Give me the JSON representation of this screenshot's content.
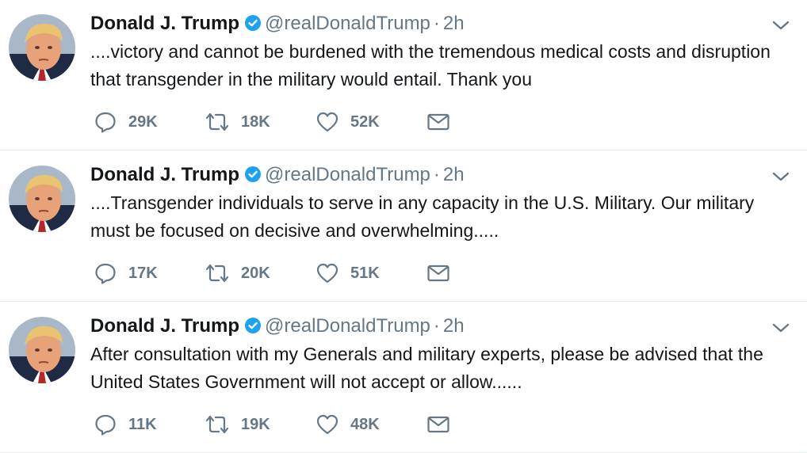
{
  "tweets": [
    {
      "fullname": "Donald J. Trump",
      "username": "@realDonaldTrump",
      "separator": "·",
      "time": "2h",
      "text": "....victory and cannot be burdened with the tremendous medical costs and disruption that transgender in the military would entail. Thank you",
      "replies": "29K",
      "retweets": "18K",
      "likes": "52K"
    },
    {
      "fullname": "Donald J. Trump",
      "username": "@realDonaldTrump",
      "separator": "·",
      "time": "2h",
      "text": "....Transgender individuals to  serve in any capacity in the U.S. Military. Our military must be focused on decisive and overwhelming.....",
      "replies": "17K",
      "retweets": "20K",
      "likes": "51K"
    },
    {
      "fullname": "Donald J. Trump",
      "username": "@realDonaldTrump",
      "separator": "·",
      "time": "2h",
      "text": "After consultation with my Generals and military experts, please be advised that the United States Government will not accept or allow......",
      "replies": "11K",
      "retweets": "19K",
      "likes": "48K"
    }
  ],
  "colors": {
    "text": "#14171a",
    "secondary": "#657786",
    "verified": "#1da1f2",
    "divider": "#e6ecf0"
  },
  "icons": {
    "reply": "reply-icon",
    "retweet": "retweet-icon",
    "like": "heart-icon",
    "message": "envelope-icon",
    "verified": "verified-badge-icon",
    "menu": "chevron-down-icon"
  }
}
